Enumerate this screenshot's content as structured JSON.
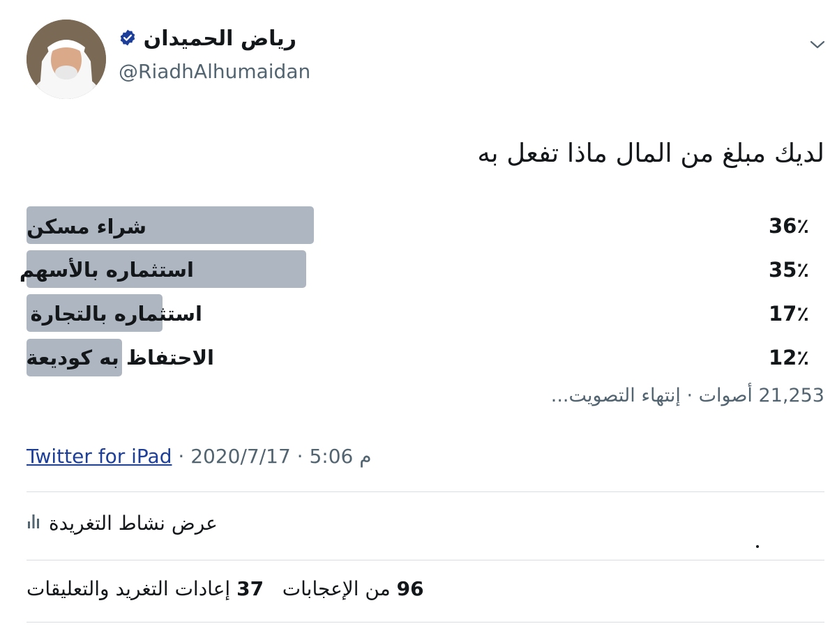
{
  "author": {
    "name": "رياض الحميدان",
    "handle": "@RiadhAlhumaidan",
    "verified": true,
    "accent": "#1d3f9a"
  },
  "tweet": {
    "text": "لديك مبلغ من المال ماذا تفعل به"
  },
  "poll": {
    "options": [
      {
        "label": "شراء مسكن",
        "percent_label": "36٪",
        "percent": 36
      },
      {
        "label": "استثماره بالأسهم",
        "percent_label": "35٪",
        "percent": 35
      },
      {
        "label": "استثماره  بالتجارة",
        "percent_label": "17٪",
        "percent": 17
      },
      {
        "label": "الاحتفاظ به كوديعة",
        "percent_label": "12٪",
        "percent": 12
      }
    ],
    "meta": "21,253 أصوات · إنتهاء التصويت...",
    "bar_color": "#aeb7c1"
  },
  "footer": {
    "time": "5:06 م",
    "date": "2020/7/17",
    "separator": " · ",
    "source": "Twitter for iPad",
    "activity_label": "عرض نشاط التغريدة",
    "activity_icon": "analytics-icon",
    "likes_count": "96",
    "likes_label": "من الإعجابات",
    "retweets_count": "37",
    "retweets_label": "إعادات التغريد والتعليقات"
  }
}
